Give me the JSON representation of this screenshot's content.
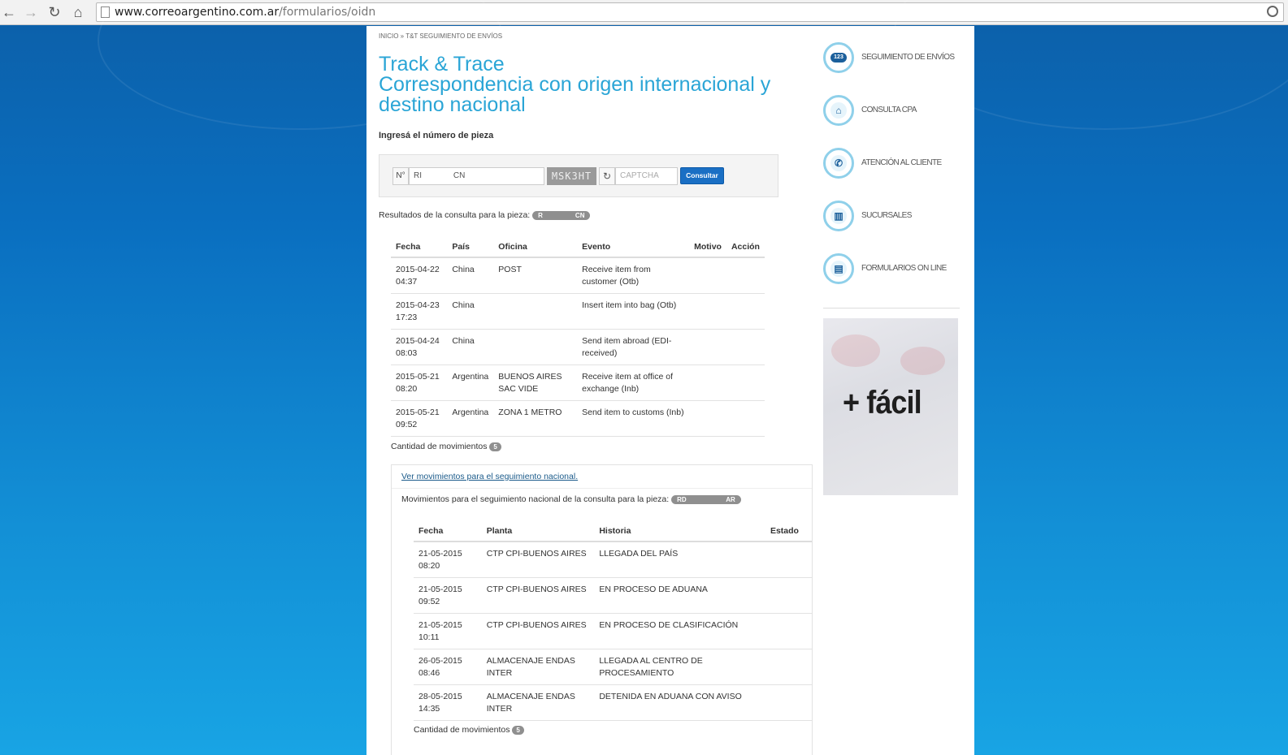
{
  "browser": {
    "url_host": "www.correoargentino.com.ar",
    "url_path": "/formularios/oidn"
  },
  "breadcrumb": "INICIO » T&T SEGUIMIENTO DE ENVÍOS",
  "title": "Track & Trace\nCorrespondencia con origen internacional y destino nacional",
  "title_line1": "Track & Trace",
  "title_line2": "Correspondencia con origen internacional y destino nacional",
  "form": {
    "prompt": "Ingresá el número de pieza",
    "n_label": "N°",
    "piece_value": "RI              CN",
    "captcha_text": "MSK3HT",
    "refresh_icon": "↻",
    "captcha_placeholder": "CAPTCHA",
    "submit_label": "Consultar"
  },
  "results": {
    "label": "Resultados de la consulta para la pieza:",
    "piece_pill": "R                  CN",
    "headers": [
      "Fecha",
      "País",
      "Oficina",
      "Evento",
      "Motivo",
      "Acción"
    ],
    "rows": [
      {
        "fecha": "2015-04-22\n04:37",
        "pais": "China",
        "oficina": "POST",
        "evento": "Receive item from customer (Otb)",
        "motivo": "",
        "accion": ""
      },
      {
        "fecha": "2015-04-23\n17:23",
        "pais": "China",
        "oficina": "",
        "evento": "Insert item into bag (Otb)",
        "motivo": "",
        "accion": ""
      },
      {
        "fecha": "2015-04-24\n08:03",
        "pais": "China",
        "oficina": "",
        "evento": "Send item abroad (EDI-received)",
        "motivo": "",
        "accion": ""
      },
      {
        "fecha": "2015-05-21\n08:20",
        "pais": "Argentina",
        "oficina": "BUENOS AIRES SAC VIDE",
        "evento": "Receive item at office of exchange (Inb)",
        "motivo": "",
        "accion": ""
      },
      {
        "fecha": "2015-05-21\n09:52",
        "pais": "Argentina",
        "oficina": "ZONA 1 METRO",
        "evento": "Send item to customs (Inb)",
        "motivo": "",
        "accion": ""
      }
    ],
    "count_label": "Cantidad de movimientos",
    "count": "5"
  },
  "national": {
    "link": "Ver movimientos para el seguimiento nacional.",
    "label": "Movimientos para el seguimiento nacional de la consulta para la pieza:",
    "piece_pill": "RD                      AR",
    "headers": [
      "Fecha",
      "Planta",
      "Historia",
      "Estado"
    ],
    "rows": [
      {
        "fecha": "21-05-2015\n08:20",
        "planta": "CTP CPI-BUENOS AIRES",
        "historia": "LLEGADA DEL PAÍS",
        "estado": ""
      },
      {
        "fecha": "21-05-2015\n09:52",
        "planta": "CTP CPI-BUENOS AIRES",
        "historia": "EN PROCESO DE ADUANA",
        "estado": ""
      },
      {
        "fecha": "21-05-2015\n10:11",
        "planta": "CTP CPI-BUENOS AIRES",
        "historia": "EN PROCESO DE CLASIFICACIÓN",
        "estado": ""
      },
      {
        "fecha": "26-05-2015\n08:46",
        "planta": "ALMACENAJE ENDAS INTER",
        "historia": "LLEGADA AL CENTRO DE PROCESAMIENTO",
        "estado": ""
      },
      {
        "fecha": "28-05-2015\n14:35",
        "planta": "ALMACENAJE ENDAS INTER",
        "historia": "DETENIDA EN ADUANA CON AVISO",
        "estado": ""
      }
    ],
    "count_label": "Cantidad de movimientos",
    "count": "5"
  },
  "sidebar": {
    "items": [
      {
        "label": "SEGUIMIENTO DE ENVÍOS",
        "icon": "tracking-123-icon",
        "glyph": "123"
      },
      {
        "label": "CONSULTA CPA",
        "icon": "house-pin-icon",
        "glyph": "⌂"
      },
      {
        "label": "ATENCIÓN AL CLIENTE",
        "icon": "phone-icon",
        "glyph": "✆"
      },
      {
        "label": "SUCURSALES",
        "icon": "branch-building-icon",
        "glyph": "▥"
      },
      {
        "label": "FORMULARIOS ON LINE",
        "icon": "form-document-icon",
        "glyph": "▤"
      }
    ]
  },
  "promo": {
    "text": "+ fácil"
  },
  "colors": {
    "accent": "#2aa5d6",
    "button": "#1a6fc4",
    "background_top": "#0c5fa8",
    "background_bottom": "#18a4e4"
  }
}
